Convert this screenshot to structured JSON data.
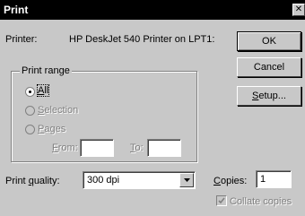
{
  "window": {
    "title": "Print",
    "close_glyph": "✕"
  },
  "printer": {
    "label": "Printer:",
    "value": "HP DeskJet 540 Printer on LPT1:"
  },
  "buttons": {
    "ok": "OK",
    "cancel": "Cancel",
    "setup_prefix": "S",
    "setup_rest": "etup..."
  },
  "print_range": {
    "legend": "Print range",
    "all": {
      "mnemonic": "A",
      "rest": "ll",
      "selected": true
    },
    "selection": {
      "mnemonic": "S",
      "rest": "election",
      "enabled": false
    },
    "pages": {
      "mnemonic": "P",
      "rest": "ages",
      "enabled": false
    },
    "from": {
      "mnemonic": "F",
      "rest": "rom:",
      "value": ""
    },
    "to": {
      "mnemonic": "T",
      "rest": "o:",
      "value": ""
    }
  },
  "print_quality": {
    "label_prefix": "Print ",
    "label_mnemonic": "q",
    "label_rest": "uality:",
    "value": "300 dpi"
  },
  "copies": {
    "label_mnemonic": "C",
    "label_rest": "opies:",
    "value": "1"
  },
  "collate": {
    "label": "Collate copies",
    "checked": true,
    "enabled": false
  },
  "colors": {
    "face": "#c8c8c8",
    "titlebar": "#000000",
    "disabled_text": "#808080"
  }
}
